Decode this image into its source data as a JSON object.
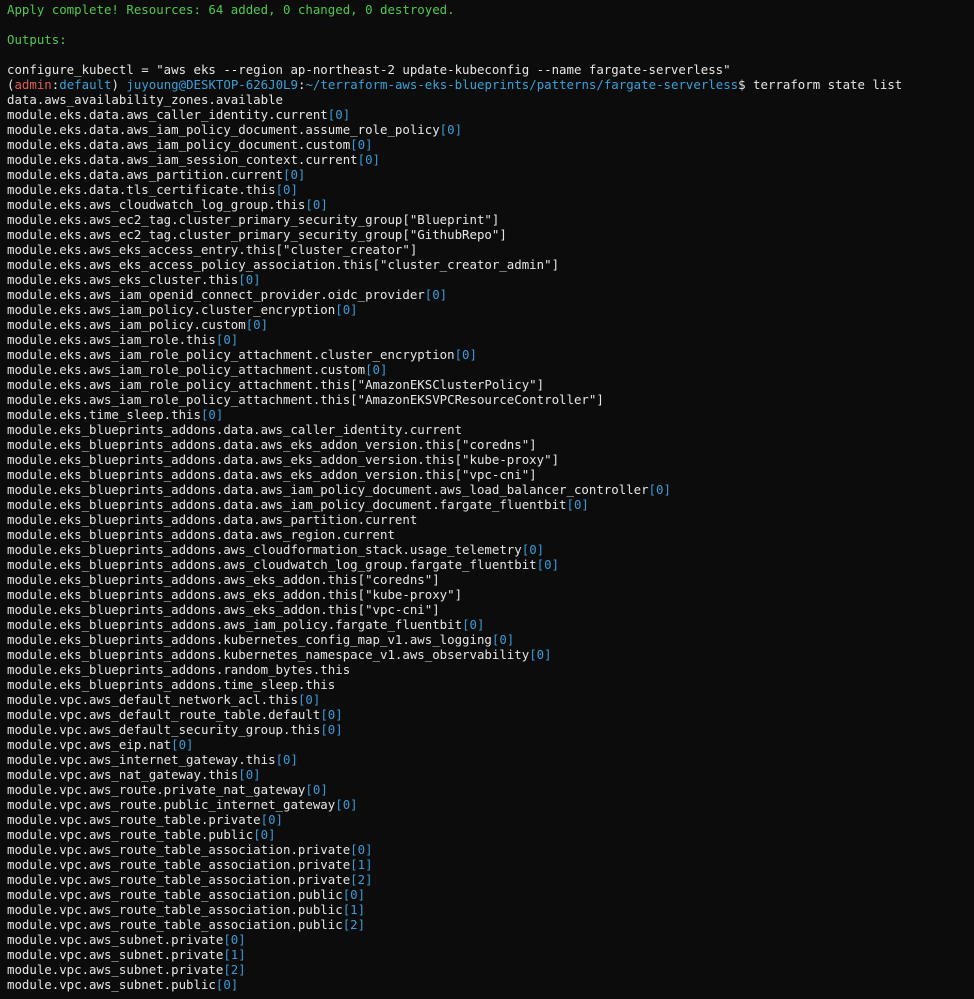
{
  "header": {
    "apply_msg": "Apply complete! Resources: 64 added, 0 changed, 0 destroyed.",
    "outputs_label": "Outputs:",
    "output_line": "configure_kubectl = \"aws eks --region ap-northeast-2 update-kubeconfig --name fargate-serverless\""
  },
  "prompt": {
    "open": "(",
    "profile": "admin",
    "sep": ":",
    "region": "default",
    "close": ")",
    "user": "juyoung@DESKTOP-626J0L9",
    "colon": ":",
    "path": "~/terraform-aws-eks-blueprints/patterns/fargate-serverless",
    "suffix": "$ ",
    "command": "terraform state list"
  },
  "resources": [
    {
      "name": "data.aws_availability_zones.available",
      "idx": ""
    },
    {
      "name": "module.eks.data.aws_caller_identity.current",
      "idx": "[0]"
    },
    {
      "name": "module.eks.data.aws_iam_policy_document.assume_role_policy",
      "idx": "[0]"
    },
    {
      "name": "module.eks.data.aws_iam_policy_document.custom",
      "idx": "[0]"
    },
    {
      "name": "module.eks.data.aws_iam_session_context.current",
      "idx": "[0]"
    },
    {
      "name": "module.eks.data.aws_partition.current",
      "idx": "[0]"
    },
    {
      "name": "module.eks.data.tls_certificate.this",
      "idx": "[0]"
    },
    {
      "name": "module.eks.aws_cloudwatch_log_group.this",
      "idx": "[0]"
    },
    {
      "name": "module.eks.aws_ec2_tag.cluster_primary_security_group[\"Blueprint\"]",
      "idx": ""
    },
    {
      "name": "module.eks.aws_ec2_tag.cluster_primary_security_group[\"GithubRepo\"]",
      "idx": ""
    },
    {
      "name": "module.eks.aws_eks_access_entry.this[\"cluster_creator\"]",
      "idx": ""
    },
    {
      "name": "module.eks.aws_eks_access_policy_association.this[\"cluster_creator_admin\"]",
      "idx": ""
    },
    {
      "name": "module.eks.aws_eks_cluster.this",
      "idx": "[0]"
    },
    {
      "name": "module.eks.aws_iam_openid_connect_provider.oidc_provider",
      "idx": "[0]"
    },
    {
      "name": "module.eks.aws_iam_policy.cluster_encryption",
      "idx": "[0]"
    },
    {
      "name": "module.eks.aws_iam_policy.custom",
      "idx": "[0]"
    },
    {
      "name": "module.eks.aws_iam_role.this",
      "idx": "[0]"
    },
    {
      "name": "module.eks.aws_iam_role_policy_attachment.cluster_encryption",
      "idx": "[0]"
    },
    {
      "name": "module.eks.aws_iam_role_policy_attachment.custom",
      "idx": "[0]"
    },
    {
      "name": "module.eks.aws_iam_role_policy_attachment.this[\"AmazonEKSClusterPolicy\"]",
      "idx": ""
    },
    {
      "name": "module.eks.aws_iam_role_policy_attachment.this[\"AmazonEKSVPCResourceController\"]",
      "idx": ""
    },
    {
      "name": "module.eks.time_sleep.this",
      "idx": "[0]"
    },
    {
      "name": "module.eks_blueprints_addons.data.aws_caller_identity.current",
      "idx": ""
    },
    {
      "name": "module.eks_blueprints_addons.data.aws_eks_addon_version.this[\"coredns\"]",
      "idx": ""
    },
    {
      "name": "module.eks_blueprints_addons.data.aws_eks_addon_version.this[\"kube-proxy\"]",
      "idx": ""
    },
    {
      "name": "module.eks_blueprints_addons.data.aws_eks_addon_version.this[\"vpc-cni\"]",
      "idx": ""
    },
    {
      "name": "module.eks_blueprints_addons.data.aws_iam_policy_document.aws_load_balancer_controller",
      "idx": "[0]"
    },
    {
      "name": "module.eks_blueprints_addons.data.aws_iam_policy_document.fargate_fluentbit",
      "idx": "[0]"
    },
    {
      "name": "module.eks_blueprints_addons.data.aws_partition.current",
      "idx": ""
    },
    {
      "name": "module.eks_blueprints_addons.data.aws_region.current",
      "idx": ""
    },
    {
      "name": "module.eks_blueprints_addons.aws_cloudformation_stack.usage_telemetry",
      "idx": "[0]"
    },
    {
      "name": "module.eks_blueprints_addons.aws_cloudwatch_log_group.fargate_fluentbit",
      "idx": "[0]"
    },
    {
      "name": "module.eks_blueprints_addons.aws_eks_addon.this[\"coredns\"]",
      "idx": ""
    },
    {
      "name": "module.eks_blueprints_addons.aws_eks_addon.this[\"kube-proxy\"]",
      "idx": ""
    },
    {
      "name": "module.eks_blueprints_addons.aws_eks_addon.this[\"vpc-cni\"]",
      "idx": ""
    },
    {
      "name": "module.eks_blueprints_addons.aws_iam_policy.fargate_fluentbit",
      "idx": "[0]"
    },
    {
      "name": "module.eks_blueprints_addons.kubernetes_config_map_v1.aws_logging",
      "idx": "[0]"
    },
    {
      "name": "module.eks_blueprints_addons.kubernetes_namespace_v1.aws_observability",
      "idx": "[0]"
    },
    {
      "name": "module.eks_blueprints_addons.random_bytes.this",
      "idx": ""
    },
    {
      "name": "module.eks_blueprints_addons.time_sleep.this",
      "idx": ""
    },
    {
      "name": "module.vpc.aws_default_network_acl.this",
      "idx": "[0]"
    },
    {
      "name": "module.vpc.aws_default_route_table.default",
      "idx": "[0]"
    },
    {
      "name": "module.vpc.aws_default_security_group.this",
      "idx": "[0]"
    },
    {
      "name": "module.vpc.aws_eip.nat",
      "idx": "[0]"
    },
    {
      "name": "module.vpc.aws_internet_gateway.this",
      "idx": "[0]"
    },
    {
      "name": "module.vpc.aws_nat_gateway.this",
      "idx": "[0]"
    },
    {
      "name": "module.vpc.aws_route.private_nat_gateway",
      "idx": "[0]"
    },
    {
      "name": "module.vpc.aws_route.public_internet_gateway",
      "idx": "[0]"
    },
    {
      "name": "module.vpc.aws_route_table.private",
      "idx": "[0]"
    },
    {
      "name": "module.vpc.aws_route_table.public",
      "idx": "[0]"
    },
    {
      "name": "module.vpc.aws_route_table_association.private",
      "idx": "[0]"
    },
    {
      "name": "module.vpc.aws_route_table_association.private",
      "idx": "[1]"
    },
    {
      "name": "module.vpc.aws_route_table_association.private",
      "idx": "[2]"
    },
    {
      "name": "module.vpc.aws_route_table_association.public",
      "idx": "[0]"
    },
    {
      "name": "module.vpc.aws_route_table_association.public",
      "idx": "[1]"
    },
    {
      "name": "module.vpc.aws_route_table_association.public",
      "idx": "[2]"
    },
    {
      "name": "module.vpc.aws_subnet.private",
      "idx": "[0]"
    },
    {
      "name": "module.vpc.aws_subnet.private",
      "idx": "[1]"
    },
    {
      "name": "module.vpc.aws_subnet.private",
      "idx": "[2]"
    },
    {
      "name": "module.vpc.aws_subnet.public",
      "idx": "[0]"
    }
  ],
  "colors": {
    "background": "#0c0c0c",
    "text": "#e6e6e6",
    "success": "#4ec94e",
    "profile": "#e05b5b",
    "path": "#3aa0d8",
    "index": "#3a9bd6"
  }
}
